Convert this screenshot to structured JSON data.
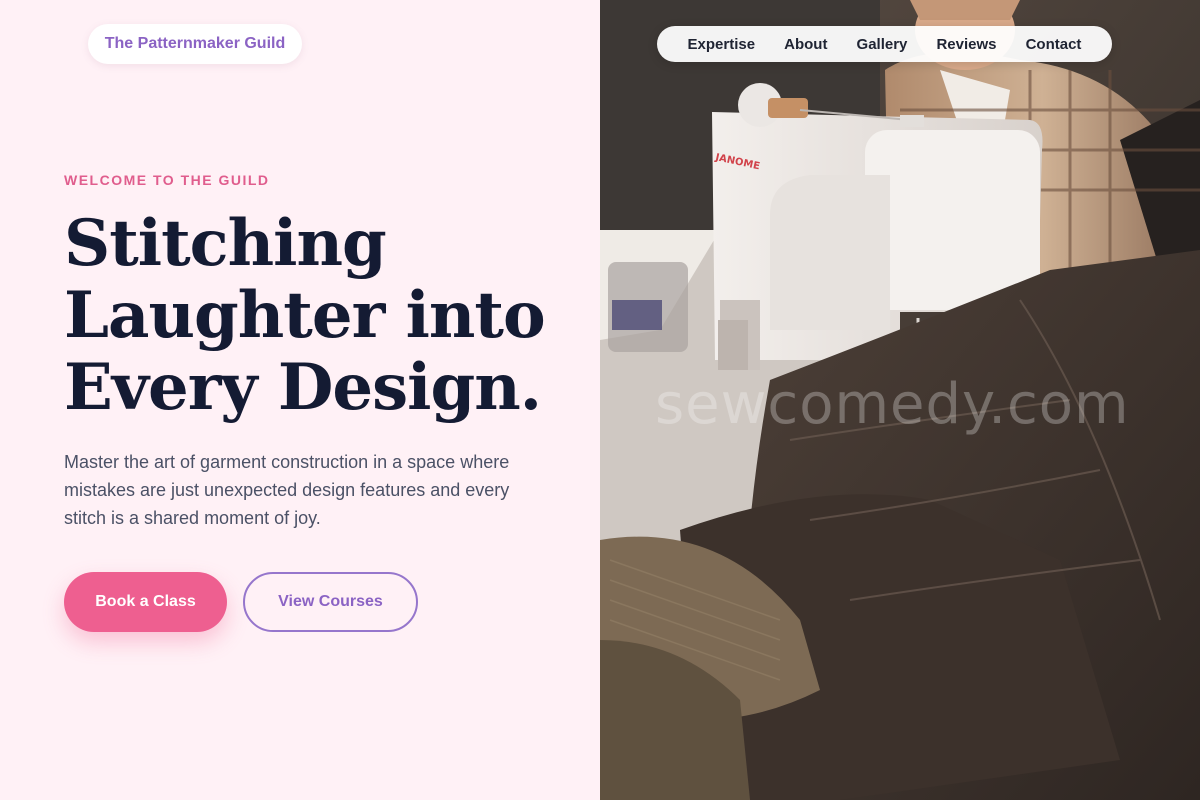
{
  "brand": {
    "name": "The Patternmaker Guild"
  },
  "nav": {
    "items": [
      "Expertise",
      "About",
      "Gallery",
      "Reviews",
      "Contact"
    ]
  },
  "hero": {
    "eyebrow": "WELCOME TO THE GUILD",
    "headline": [
      "Stitching",
      "Laughter into",
      "Every Design."
    ],
    "lede": "Master the art of garment construction in a space where mistakes are just unexpected design features and every stitch is a shared moment of joy.",
    "primary_cta": "Book a Class",
    "secondary_cta": "View Courses"
  },
  "photo": {
    "watermark": "sewcomedy.com",
    "machine_brand": "JANOME"
  },
  "colors": {
    "background": "#fff1f6",
    "accent_pink": "#ee5f90",
    "accent_purple": "#8b63c4",
    "headline": "#141b33"
  }
}
